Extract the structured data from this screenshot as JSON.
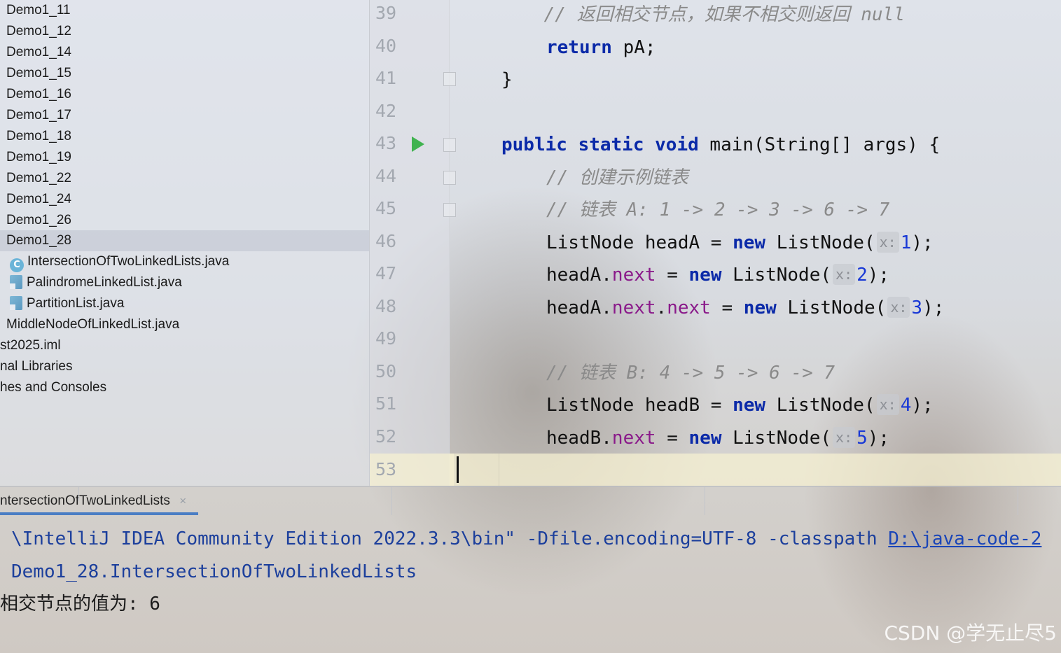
{
  "project_tree": {
    "items": [
      {
        "label": "Demo1_11"
      },
      {
        "label": "Demo1_12"
      },
      {
        "label": "Demo1_14"
      },
      {
        "label": "Demo1_15"
      },
      {
        "label": "Demo1_16"
      },
      {
        "label": "Demo1_17"
      },
      {
        "label": "Demo1_18"
      },
      {
        "label": "Demo1_19"
      },
      {
        "label": "Demo1_22"
      },
      {
        "label": "Demo1_24"
      },
      {
        "label": "Demo1_26"
      },
      {
        "label": "Demo1_28"
      },
      {
        "label": "IntersectionOfTwoLinkedLists.java"
      },
      {
        "label": "PalindromeLinkedList.java"
      },
      {
        "label": "PartitionList.java"
      },
      {
        "label": "MiddleNodeOfLinkedList.java"
      },
      {
        "label": "st2025.iml"
      },
      {
        "label": "nal Libraries"
      },
      {
        "label": "hes and Consoles"
      }
    ]
  },
  "editor": {
    "line_numbers": [
      "39",
      "40",
      "41",
      "42",
      "43",
      "44",
      "45",
      "46",
      "47",
      "48",
      "49",
      "50",
      "51",
      "52",
      "53"
    ],
    "lines": {
      "l39_comment": "// 返回相交节点，如果不相交则返回 null",
      "l40_kw": "return",
      "l40_rest": " pA;",
      "l41": "}",
      "l43_kw": "public static void",
      "l43_rest": " main(String[] args) {",
      "l44_comment": "// 创建示例链表",
      "l45_comment": "// 链表 A: 1 -> 2 -> 3 -> 6 -> 7",
      "l46_pre": "ListNode headA = ",
      "l46_kw": "new",
      "l46_post": " ListNode(",
      "l46_hint": "x:",
      "l46_num": "1",
      "l46_end": ");",
      "l47_pre": "headA.",
      "l47_field": "next",
      "l47_mid": " = ",
      "l47_kw": "new",
      "l47_post": " ListNode(",
      "l47_hint": "x:",
      "l47_num": "2",
      "l47_end": ");",
      "l48_pre": "headA.",
      "l48_field1": "next",
      "l48_dot": ".",
      "l48_field2": "next",
      "l48_mid": " = ",
      "l48_kw": "new",
      "l48_post": " ListNode(",
      "l48_hint": "x:",
      "l48_num": "3",
      "l48_end": ");",
      "l50_comment": "// 链表 B: 4 -> 5 -> 6 -> 7",
      "l51_pre": "ListNode headB = ",
      "l51_kw": "new",
      "l51_post": " ListNode(",
      "l51_hint": "x:",
      "l51_num": "4",
      "l51_end": ");",
      "l52_pre": "headB.",
      "l52_field": "next",
      "l52_mid": " = ",
      "l52_kw": "new",
      "l52_post": " ListNode(",
      "l52_hint": "x:",
      "l52_num": "5",
      "l52_end": ");"
    }
  },
  "run_panel": {
    "tab_label": "ntersectionOfTwoLinkedLists",
    "tab_close": "×",
    "console": {
      "line1_text": "\\IntelliJ IDEA Community Edition 2022.3.3\\bin\" -Dfile.encoding=UTF-8 -classpath ",
      "line1_link": "D:\\java-code-2",
      "line2": "Demo1_28.IntersectionOfTwoLinkedLists",
      "line3": "相交节点的值为: 6"
    }
  },
  "watermark": "CSDN @学无止尽5"
}
